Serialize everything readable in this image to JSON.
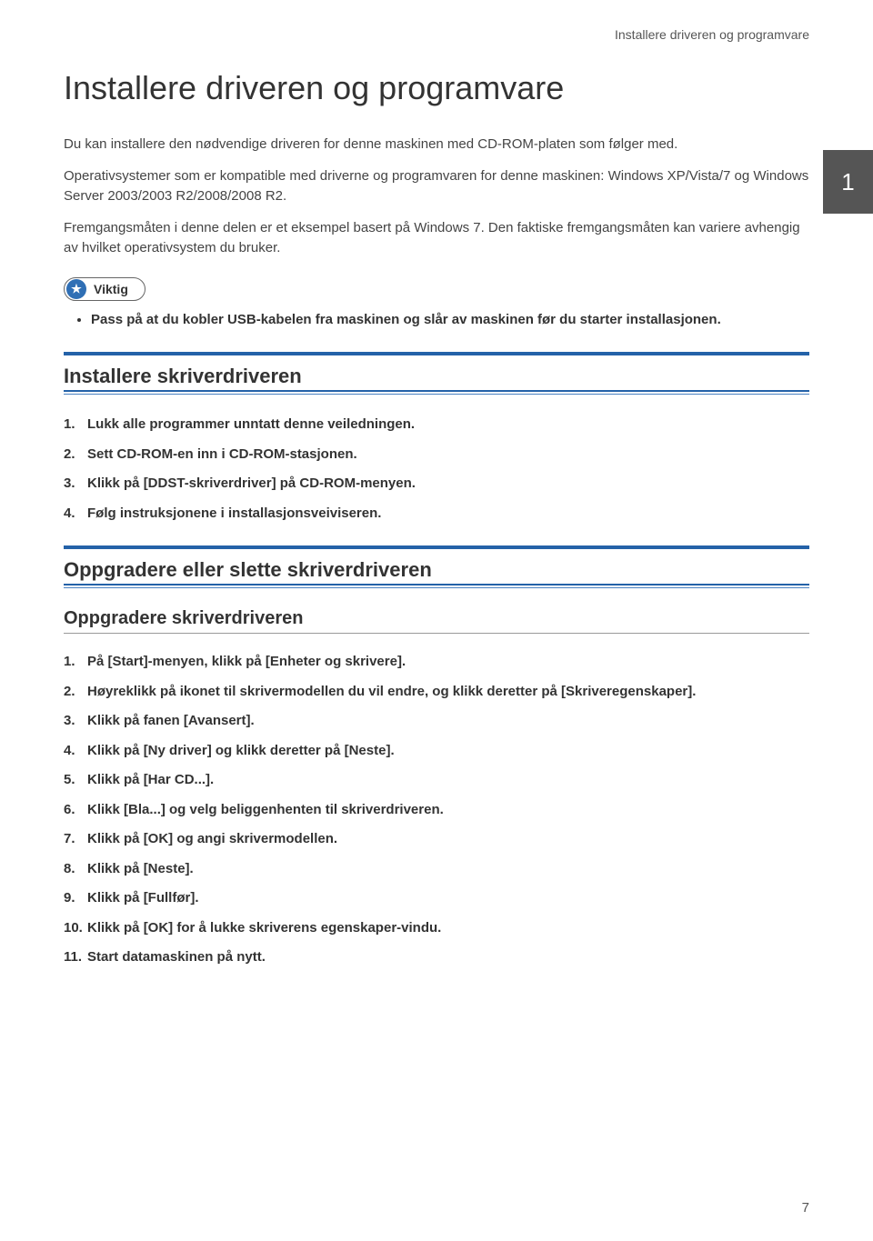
{
  "header": {
    "running_title": "Installere driveren og programvare"
  },
  "chapter_number": "1",
  "title": "Installere driveren og programvare",
  "intro_paragraphs": [
    "Du kan installere den nødvendige driveren for denne maskinen med CD-ROM-platen som følger med.",
    "Operativsystemer som er kompatible med driverne og programvaren for denne maskinen: Windows XP/Vista/7 og Windows Server 2003/2003 R2/2008/2008 R2.",
    "Fremgangsmåten i denne delen er et eksempel basert på Windows 7. Den faktiske fremgangsmåten kan variere avhengig av hvilket operativsystem du bruker."
  ],
  "callout_label": "Viktig",
  "callout_bullet": "Pass på at du kobler USB-kabelen fra maskinen og slår av maskinen før du starter installasjonen.",
  "section1": {
    "heading": "Installere skriverdriveren",
    "steps": [
      "Lukk alle programmer unntatt denne veiledningen.",
      "Sett CD-ROM-en inn i CD-ROM-stasjonen.",
      "Klikk på [DDST-skriverdriver] på CD-ROM-menyen.",
      "Følg instruksjonene i installasjonsveiviseren."
    ]
  },
  "section2": {
    "heading": "Oppgradere eller slette skriverdriveren",
    "subsection_heading": "Oppgradere skriverdriveren",
    "steps": [
      "På [Start]-menyen, klikk på [Enheter og skrivere].",
      "Høyreklikk på ikonet til skrivermodellen du vil endre, og klikk deretter på [Skriveregenskaper].",
      "Klikk på fanen [Avansert].",
      "Klikk på [Ny driver] og klikk deretter på [Neste].",
      "Klikk på [Har CD...].",
      "Klikk [Bla...] og velg beliggenhenten til skriverdriveren.",
      "Klikk på [OK] og angi skrivermodellen.",
      "Klikk på [Neste].",
      "Klikk på [Fullfør].",
      "Klikk på [OK] for å lukke skriverens egenskaper-vindu.",
      "Start datamaskinen på nytt."
    ]
  },
  "page_number": "7"
}
